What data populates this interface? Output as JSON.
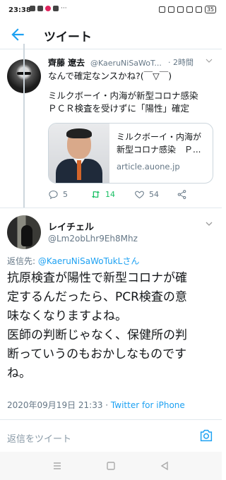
{
  "status_bar": {
    "time": "23:38",
    "battery": "35",
    "left_overflow": "···"
  },
  "app_bar": {
    "title": "ツイート",
    "back_icon": "arrow-left-icon"
  },
  "original_tweet": {
    "author_name": "齊藤 遼去",
    "author_handle": "@KaeruNiSaWoT...",
    "time_ago": "· 2時間",
    "text_lines": [
      "なんで確定なンスかね?(￣▽￣)",
      "",
      "ミルクボーイ・内海が新型コロナ感染",
      "ＰＣＲ検査を受けずに「陽性」確定"
    ],
    "link_card": {
      "title_lines": [
        "ミルクボーイ・内海が",
        "新型コロナ感染　Ｐ..."
      ],
      "domain": "article.auone.jp"
    },
    "actions": {
      "replies": "5",
      "retweets": "14",
      "likes": "54"
    }
  },
  "reply_tweet": {
    "author_name": "レイチェル",
    "author_handle": "@Lm2obLhr9Eh8Mhz",
    "reply_prefix": "返信先: ",
    "reply_mention": "@KaeruNiSaWoTukLさん",
    "body_lines": [
      "抗原検査が陽性で新型コロナが確",
      "定するんだったら、PCR検査の意",
      "味なくなりますよね。",
      "医師の判断じゃなく、保健所の判",
      "断っていうのもおかしなものです",
      "ね。"
    ],
    "timestamp": "2020年09月19日 21:33 · ",
    "source": "Twitter for iPhone"
  },
  "reply_bar": {
    "placeholder": "返信をツイート"
  },
  "colors": {
    "accent": "#1da1f2",
    "retweet": "#17bf63",
    "muted": "#657786"
  }
}
